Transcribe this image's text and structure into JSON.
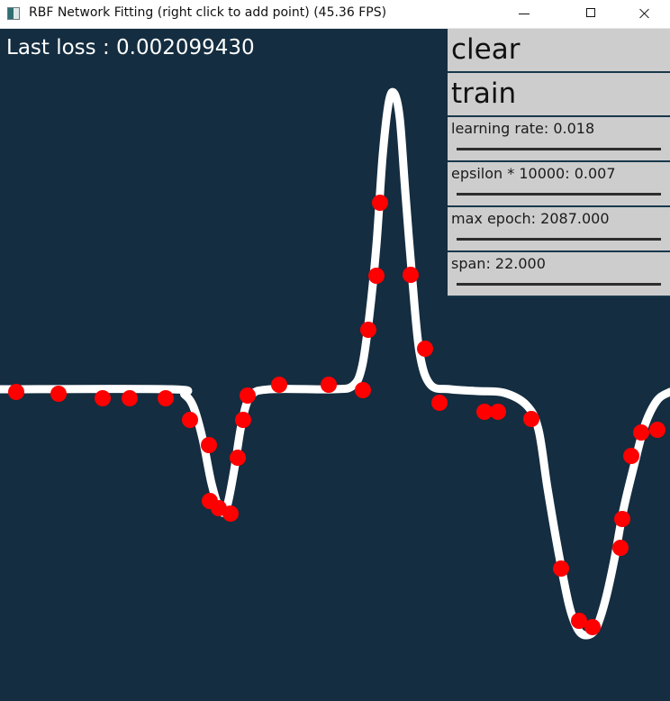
{
  "window": {
    "title": "RBF Network Fitting (right click to add point) (45.36 FPS)",
    "controls": [
      "minimize",
      "maximize",
      "close"
    ]
  },
  "status": {
    "loss_text": "Last loss : 0.002099430"
  },
  "panel": {
    "clear_label": "clear",
    "train_label": "train",
    "sliders": [
      {
        "label": "learning rate: 0.018",
        "value": 0.018
      },
      {
        "label": "epsilon * 10000: 0.007",
        "value": 0.007
      },
      {
        "label": "max epoch: 2087.000",
        "value": 2087.0
      },
      {
        "label": "span: 22.000",
        "value": 22.0
      }
    ]
  },
  "colors": {
    "background": "#142d40",
    "curve": "#ffffff",
    "points": "#ff0000",
    "panel": "#cdcdcd"
  },
  "chart_data": {
    "type": "scatter",
    "title": "",
    "xlabel": "",
    "ylabel": "",
    "grid": false,
    "points": [
      [
        18,
        403
      ],
      [
        65,
        405
      ],
      [
        114,
        410
      ],
      [
        144,
        410
      ],
      [
        184,
        410
      ],
      [
        211,
        434
      ],
      [
        232,
        462
      ],
      [
        233,
        524
      ],
      [
        243,
        532
      ],
      [
        256,
        538
      ],
      [
        264,
        476
      ],
      [
        270,
        434
      ],
      [
        275,
        407
      ],
      [
        310,
        395
      ],
      [
        365,
        395
      ],
      [
        403,
        401
      ],
      [
        409,
        334
      ],
      [
        418,
        274
      ],
      [
        422,
        193
      ],
      [
        456,
        273
      ],
      [
        472,
        355
      ],
      [
        488,
        415
      ],
      [
        538,
        425
      ],
      [
        553,
        425
      ],
      [
        590,
        433
      ],
      [
        623,
        599
      ],
      [
        643,
        657
      ],
      [
        658,
        664
      ],
      [
        689,
        576
      ],
      [
        691,
        544
      ],
      [
        701,
        474
      ],
      [
        712,
        448
      ],
      [
        730,
        445
      ]
    ],
    "curve": [
      [
        0,
        400
      ],
      [
        190,
        400
      ],
      [
        205,
        406
      ],
      [
        215,
        420
      ],
      [
        225,
        455
      ],
      [
        235,
        505
      ],
      [
        245,
        535
      ],
      [
        252,
        530
      ],
      [
        260,
        490
      ],
      [
        268,
        440
      ],
      [
        278,
        408
      ],
      [
        300,
        400
      ],
      [
        370,
        400
      ],
      [
        392,
        396
      ],
      [
        402,
        375
      ],
      [
        410,
        320
      ],
      [
        418,
        240
      ],
      [
        425,
        140
      ],
      [
        432,
        80
      ],
      [
        438,
        72
      ],
      [
        444,
        100
      ],
      [
        450,
        180
      ],
      [
        458,
        280
      ],
      [
        466,
        360
      ],
      [
        478,
        395
      ],
      [
        500,
        400
      ],
      [
        530,
        402
      ],
      [
        560,
        404
      ],
      [
        585,
        418
      ],
      [
        598,
        445
      ],
      [
        608,
        510
      ],
      [
        620,
        580
      ],
      [
        632,
        640
      ],
      [
        642,
        667
      ],
      [
        652,
        673
      ],
      [
        662,
        665
      ],
      [
        672,
        635
      ],
      [
        682,
        590
      ],
      [
        692,
        535
      ],
      [
        704,
        485
      ],
      [
        716,
        440
      ],
      [
        730,
        412
      ],
      [
        744,
        403
      ]
    ]
  }
}
